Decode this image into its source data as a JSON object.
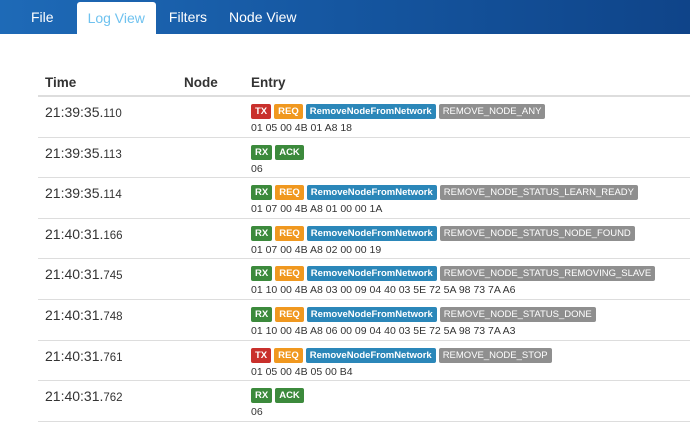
{
  "nav": {
    "tabs": [
      "File",
      "Log View",
      "Filters",
      "Node View"
    ],
    "active_index": 1
  },
  "table": {
    "headers": {
      "time": "Time",
      "node": "Node",
      "entry": "Entry"
    },
    "rows": [
      {
        "time_main": "21:39:35.",
        "time_ms": "110",
        "node": "",
        "badges": [
          {
            "text": "TX",
            "kind": "tx"
          },
          {
            "text": "REQ",
            "kind": "req"
          },
          {
            "text": "RemoveNodeFromNetwork",
            "kind": "cmd"
          },
          {
            "text": "REMOVE_NODE_ANY",
            "kind": "state"
          }
        ],
        "payload": "01 05 00 4B 01 A8 18"
      },
      {
        "time_main": "21:39:35.",
        "time_ms": "113",
        "node": "",
        "badges": [
          {
            "text": "RX",
            "kind": "rx"
          },
          {
            "text": "ACK",
            "kind": "ack"
          }
        ],
        "payload": "06"
      },
      {
        "time_main": "21:39:35.",
        "time_ms": "114",
        "node": "",
        "badges": [
          {
            "text": "RX",
            "kind": "rx"
          },
          {
            "text": "REQ",
            "kind": "req"
          },
          {
            "text": "RemoveNodeFromNetwork",
            "kind": "cmd"
          },
          {
            "text": "REMOVE_NODE_STATUS_LEARN_READY",
            "kind": "state"
          }
        ],
        "payload": "01 07 00 4B A8 01 00 00 1A"
      },
      {
        "time_main": "21:40:31.",
        "time_ms": "166",
        "node": "",
        "badges": [
          {
            "text": "RX",
            "kind": "rx"
          },
          {
            "text": "REQ",
            "kind": "req"
          },
          {
            "text": "RemoveNodeFromNetwork",
            "kind": "cmd"
          },
          {
            "text": "REMOVE_NODE_STATUS_NODE_FOUND",
            "kind": "state"
          }
        ],
        "payload": "01 07 00 4B A8 02 00 00 19"
      },
      {
        "time_main": "21:40:31.",
        "time_ms": "745",
        "node": "",
        "badges": [
          {
            "text": "RX",
            "kind": "rx"
          },
          {
            "text": "REQ",
            "kind": "req"
          },
          {
            "text": "RemoveNodeFromNetwork",
            "kind": "cmd"
          },
          {
            "text": "REMOVE_NODE_STATUS_REMOVING_SLAVE",
            "kind": "state"
          }
        ],
        "payload": "01 10 00 4B A8 03 00 09 04 40 03 5E 72 5A 98 73 7A A6"
      },
      {
        "time_main": "21:40:31.",
        "time_ms": "748",
        "node": "",
        "badges": [
          {
            "text": "RX",
            "kind": "rx"
          },
          {
            "text": "REQ",
            "kind": "req"
          },
          {
            "text": "RemoveNodeFromNetwork",
            "kind": "cmd"
          },
          {
            "text": "REMOVE_NODE_STATUS_DONE",
            "kind": "state"
          }
        ],
        "payload": "01 10 00 4B A8 06 00 09 04 40 03 5E 72 5A 98 73 7A A3"
      },
      {
        "time_main": "21:40:31.",
        "time_ms": "761",
        "node": "",
        "badges": [
          {
            "text": "TX",
            "kind": "tx"
          },
          {
            "text": "REQ",
            "kind": "req"
          },
          {
            "text": "RemoveNodeFromNetwork",
            "kind": "cmd"
          },
          {
            "text": "REMOVE_NODE_STOP",
            "kind": "state"
          }
        ],
        "payload": "01 05 00 4B 05 00 B4"
      },
      {
        "time_main": "21:40:31.",
        "time_ms": "762",
        "node": "",
        "badges": [
          {
            "text": "RX",
            "kind": "rx"
          },
          {
            "text": "ACK",
            "kind": "ack"
          }
        ],
        "payload": "06"
      }
    ]
  },
  "colors": {
    "navbar": "#1556a0",
    "tx": "#c9302c",
    "rx": "#3c8a3c",
    "req": "#f0981f",
    "cmd": "#2b87b9",
    "state": "#8f8f8f",
    "active_tab_text": "#6fc2ef"
  }
}
